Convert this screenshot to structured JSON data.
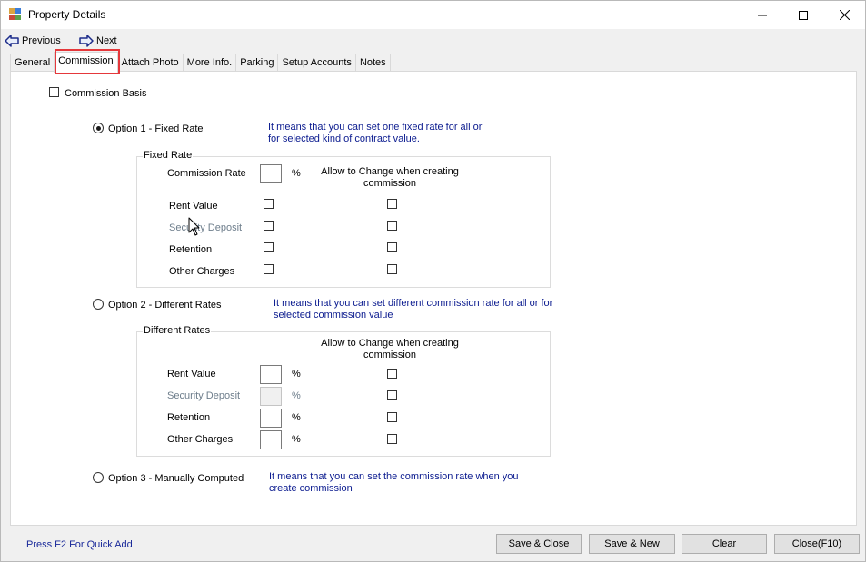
{
  "window": {
    "title": "Property Details",
    "controls": [
      "minimize-icon",
      "maximize-icon",
      "close-icon"
    ]
  },
  "nav": {
    "previous": "Previous",
    "next": "Next"
  },
  "tabs": [
    {
      "label": "General",
      "active": false
    },
    {
      "label": "Commission",
      "active": true
    },
    {
      "label": "Attach Photo",
      "active": false
    },
    {
      "label": "More Info.",
      "active": false
    },
    {
      "label": "Parking",
      "active": false
    },
    {
      "label": "Setup Accounts",
      "active": false
    },
    {
      "label": "Notes",
      "active": false
    }
  ],
  "commission": {
    "basis_label": "Commission Basis",
    "basis_checked": false,
    "option1": {
      "label": "Option 1 - Fixed Rate",
      "selected": true,
      "info_line1": "It means that you can set one fixed rate for all or",
      "info_line2": "for selected kind of contract value.",
      "group_title": "Fixed Rate",
      "rate_label": "Commission Rate",
      "rate_value": "",
      "percent": "%",
      "allow_line1": "Allow to Change when creating",
      "allow_line2": "commission",
      "rows": [
        {
          "label": "Rent Value",
          "checked": false,
          "allow": false,
          "disabled": false
        },
        {
          "label": "Security Deposit",
          "checked": false,
          "allow": false,
          "disabled": true
        },
        {
          "label": "Retention",
          "checked": false,
          "allow": false,
          "disabled": false
        },
        {
          "label": "Other Charges",
          "checked": false,
          "allow": false,
          "disabled": false
        }
      ]
    },
    "option2": {
      "label": "Option 2 - Different Rates",
      "selected": false,
      "info_line1": "It means that you can set different commission rate for all or for",
      "info_line2": "selected commission value",
      "group_title": "Different Rates",
      "allow_line1": "Allow to Change when creating",
      "allow_line2": "commission",
      "percent": "%",
      "rows": [
        {
          "label": "Rent Value",
          "value": "",
          "allow": false,
          "disabled": false
        },
        {
          "label": "Security Deposit",
          "value": "",
          "allow": false,
          "disabled": true
        },
        {
          "label": "Retention",
          "value": "",
          "allow": false,
          "disabled": false
        },
        {
          "label": "Other Charges",
          "value": "",
          "allow": false,
          "disabled": false
        }
      ]
    },
    "option3": {
      "label": "Option 3 - Manually Computed",
      "selected": false,
      "info_line1": "It means that you can set the commission rate when you",
      "info_line2": "create commission"
    }
  },
  "footer": {
    "quick_add": "Press F2 For Quick Add",
    "buttons": {
      "save_close": "Save & Close",
      "save_new": "Save & New",
      "clear": "Clear",
      "close": "Close(F10)"
    }
  },
  "colors": {
    "info_text": "#0b1b8f",
    "disabled_text": "#6d7d8b",
    "highlight": "#e5383b",
    "link": "#1a2a9a"
  }
}
